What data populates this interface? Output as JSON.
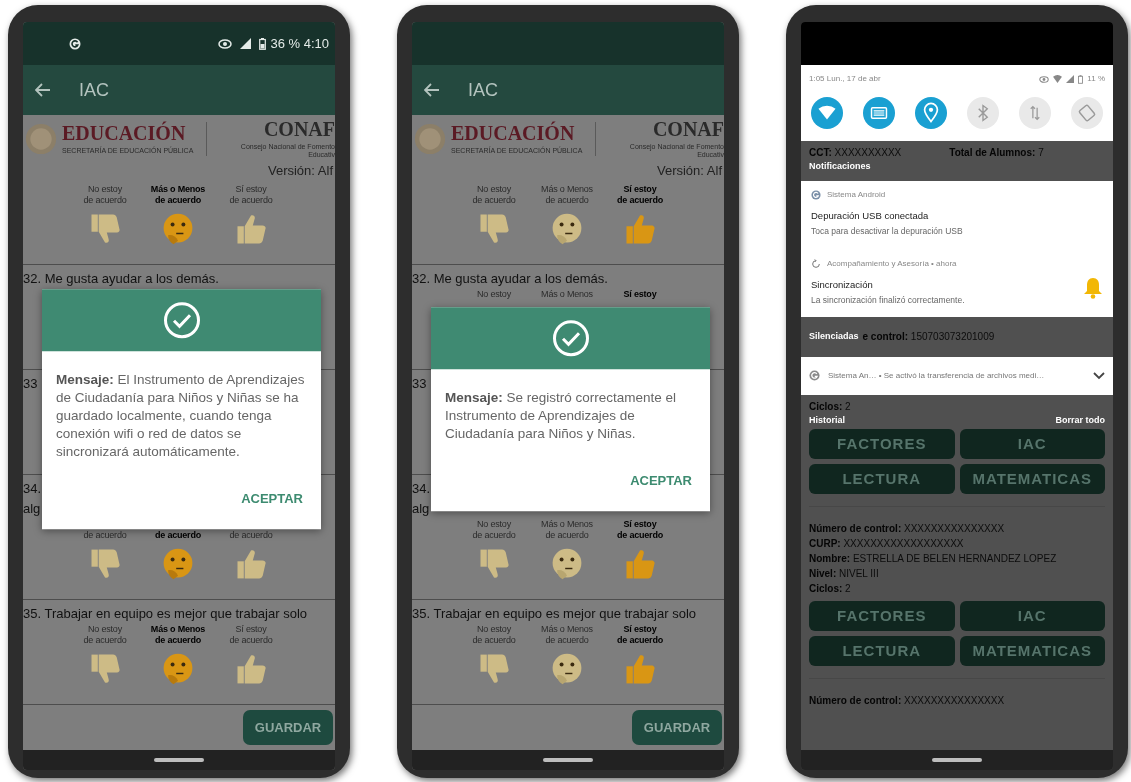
{
  "phones": [
    {
      "kind": "app",
      "status": {
        "text": "36 % 4:10"
      },
      "app_bar": {
        "title": "IAC"
      },
      "header": {
        "brand": "EDUCACIÓN",
        "brand_sub": "SECRETARÍA DE EDUCACIÓN PÚBLICA",
        "partner": "CONAF",
        "partner_sub": "Consejo Nacional de Fomento Educativ"
      },
      "version": "Versión: Alf",
      "questions": [
        {
          "options": [
            {
              "kind": "thumbs_down",
              "line1": "No estoy",
              "line2": "de acuerdo",
              "selected": false
            },
            {
              "kind": "thinking",
              "line1": "Más o Menos",
              "line2": "de acuerdo",
              "selected": true
            },
            {
              "kind": "thumbs_up",
              "line1": "Sí estoy",
              "line2": "de acuerdo",
              "selected": false
            }
          ]
        },
        {
          "lines": [
            "32. Me gusta ayudar a los demás."
          ]
        },
        {
          "lines": [
            "33"
          ]
        },
        {
          "lines": [
            "34.",
            "alg"
          ],
          "options": [
            {
              "kind": "thumbs_down",
              "line2": "de acuerdo",
              "selected": false
            },
            {
              "kind": "thinking",
              "line2": "de acuerdo",
              "selected": true
            },
            {
              "kind": "thumbs_up",
              "line2": "de acuerdo",
              "selected": false
            }
          ]
        },
        {
          "lines": [
            "35. Trabajar en equipo es mejor que trabajar solo"
          ],
          "options": [
            {
              "kind": "thumbs_down",
              "line1": "No estoy",
              "line2": "de acuerdo",
              "selected": false
            },
            {
              "kind": "thinking",
              "line1": "Más o Menos",
              "line2": "de acuerdo",
              "selected": true
            },
            {
              "kind": "thumbs_up",
              "line1": "Sí estoy",
              "line2": "de acuerdo",
              "selected": false
            }
          ]
        }
      ],
      "save_button": "GUARDAR",
      "dialog": {
        "message": "**Mensaje:** El Instrumento de Aprendizajes de Ciudadanía para Niños y Niñas se ha guardado localmente, cuando tenga conexión wifi o red de datos se sincronizará automáticamente.",
        "button": "ACEPTAR"
      }
    },
    {
      "kind": "app",
      "app_bar": {
        "title": "IAC"
      },
      "header": {
        "brand": "EDUCACIÓN",
        "brand_sub": "SECRETARÍA DE EDUCACIÓN PÚBLICA",
        "partner": "CONAF",
        "partner_sub": "Consejo Nacional de Fomento Educativ"
      },
      "version": "Versión: Alf",
      "questions": [
        {
          "options": [
            {
              "kind": "thumbs_down",
              "line1": "No estoy",
              "line2": "de acuerdo",
              "selected": false
            },
            {
              "kind": "thinking",
              "line1": "Más o Menos",
              "line2": "de acuerdo",
              "selected": false
            },
            {
              "kind": "thumbs_up",
              "line1": "Sí estoy",
              "line2": "de acuerdo",
              "selected": true
            }
          ]
        },
        {
          "lines": [
            "32. Me gusta ayudar a los demás."
          ],
          "options": [
            {
              "line1": "No estoy",
              "selected": false
            },
            {
              "line1": "Más o Menos",
              "selected": false
            },
            {
              "line1": "Sí estoy",
              "selected": true
            }
          ]
        },
        {
          "lines": [
            "33"
          ]
        },
        {
          "lines": [
            "34.",
            "alg"
          ],
          "options": [
            {
              "kind": "thumbs_down",
              "line1": "No estoy",
              "line2": "de acuerdo",
              "selected": false
            },
            {
              "kind": "thinking",
              "line1": "Más o Menos",
              "line2": "de acuerdo",
              "selected": false
            },
            {
              "kind": "thumbs_up",
              "line1": "Sí estoy",
              "line2": "de acuerdo",
              "selected": true
            }
          ]
        },
        {
          "lines": [
            "35. Trabajar en equipo es mejor que trabajar solo"
          ],
          "options": [
            {
              "kind": "thumbs_down",
              "line1": "No estoy",
              "line2": "de acuerdo",
              "selected": false
            },
            {
              "kind": "thinking",
              "line1": "Más o Menos",
              "line2": "de acuerdo",
              "selected": false
            },
            {
              "kind": "thumbs_up",
              "line1": "Sí estoy",
              "line2": "de acuerdo",
              "selected": true
            }
          ]
        }
      ],
      "save_button": "GUARDAR",
      "dialog": {
        "message": "**Mensaje:** Se registró correctamente el Instrumento de Aprendizajes de Ciudadanía para Niños y Niñas.",
        "button": "ACEPTAR"
      }
    },
    {
      "kind": "notifications",
      "shade": {
        "clock": "1:05 Lun., 17 de abr",
        "battery": "11 %",
        "toggles": [
          {
            "kind": "wifi",
            "on": true
          },
          {
            "kind": "nfc",
            "on": true
          },
          {
            "kind": "location",
            "on": true
          },
          {
            "kind": "bluetooth",
            "on": false
          },
          {
            "kind": "data",
            "on": false
          },
          {
            "kind": "rotate",
            "on": false
          }
        ]
      },
      "behind_top": [
        "**CCT:** XXXXXXXXXX",
        "**Total de Alumnos:** 7"
      ],
      "notifications_header": "Notificaciones",
      "notifications": [
        {
          "kind": "android",
          "app": "Sistema Android",
          "title": "Depuración USB conectada",
          "body": "Toca para desactivar la depuración USB"
        },
        {
          "kind": "sync",
          "app": "Acompañamiento y Asesoría • ahora",
          "title": "Sincronización",
          "body": "La sincronización finalizó correctamente.",
          "bell": true
        }
      ],
      "silenced_label": "Silenciadas",
      "silenced_behind": "**e control:** 150703073201009",
      "silenced_row": "Sistema An… • Se activó la transferencia de archivos medi…",
      "behind_ciclos": "**Ciclos:** 2",
      "history_label": "Historial",
      "clear_all": "Borrar todo",
      "buttons_top": [
        "FACTORES",
        "IAC",
        "LECTURA",
        "MATEMATICAS"
      ],
      "student": {
        "fields": [
          "**Número de control:** XXXXXXXXXXXXXXX",
          "**CURP:** XXXXXXXXXXXXXXXXXX",
          "**Nombre:** ESTRELLA DE BELEN HERNANDEZ LOPEZ",
          "**Nivel:** NIVEL III",
          "**Ciclos:** 2"
        ],
        "buttons": [
          "FACTORES",
          "IAC",
          "LECTURA",
          "MATEMATICAS"
        ]
      },
      "next_student": "**Número de control:** XXXXXXXXXXXXXXX"
    }
  ]
}
